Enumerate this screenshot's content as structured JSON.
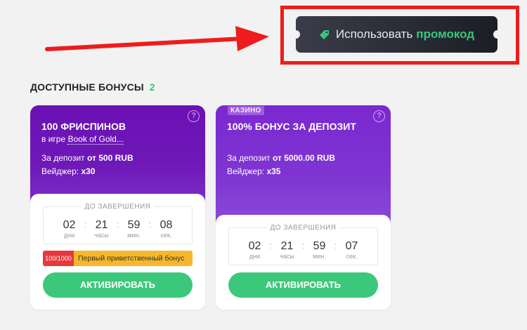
{
  "promo": {
    "label": "Использовать",
    "accent": "промокод",
    "icon": "tag-icon"
  },
  "section": {
    "title": "ДОСТУПНЫЕ БОНУСЫ",
    "count": "2"
  },
  "cards": [
    {
      "title": "100 ФРИСПИНОВ",
      "game_prefix": "в игре",
      "game_name": "Book of Gold...",
      "deposit_label": "За депозит",
      "deposit_value": "от 500 RUB",
      "wager_label": "Вейджер:",
      "wager_value": "x30",
      "help": "?",
      "timer_label": "ДО ЗАВЕРШЕНИЯ",
      "timer": {
        "d": "02",
        "h": "21",
        "m": "59",
        "s": "08",
        "d_cap": "дни",
        "h_cap": "часы",
        "m_cap": "мин.",
        "s_cap": "сек."
      },
      "limit": "100/1000",
      "first_bonus": "Первый приветственный бонус",
      "activate": "АКТИВИРОВАТЬ"
    },
    {
      "badge": "КАЗИНО",
      "title": "100% БОНУС ЗА ДЕПОЗИТ",
      "deposit_label": "За депозит",
      "deposit_value": "от 5000.00 RUB",
      "wager_label": "Вейджер:",
      "wager_value": "x35",
      "help": "?",
      "timer_label": "ДО ЗАВЕРШЕНИЯ",
      "timer": {
        "d": "02",
        "h": "21",
        "m": "59",
        "s": "07",
        "d_cap": "дни",
        "h_cap": "часы",
        "m_cap": "мин.",
        "s_cap": "сек."
      },
      "activate": "АКТИВИРОВАТЬ"
    }
  ],
  "colors": {
    "accent_green": "#3cc87a",
    "purple": "#6b11b3",
    "annotation_red": "#ee1c1c"
  }
}
